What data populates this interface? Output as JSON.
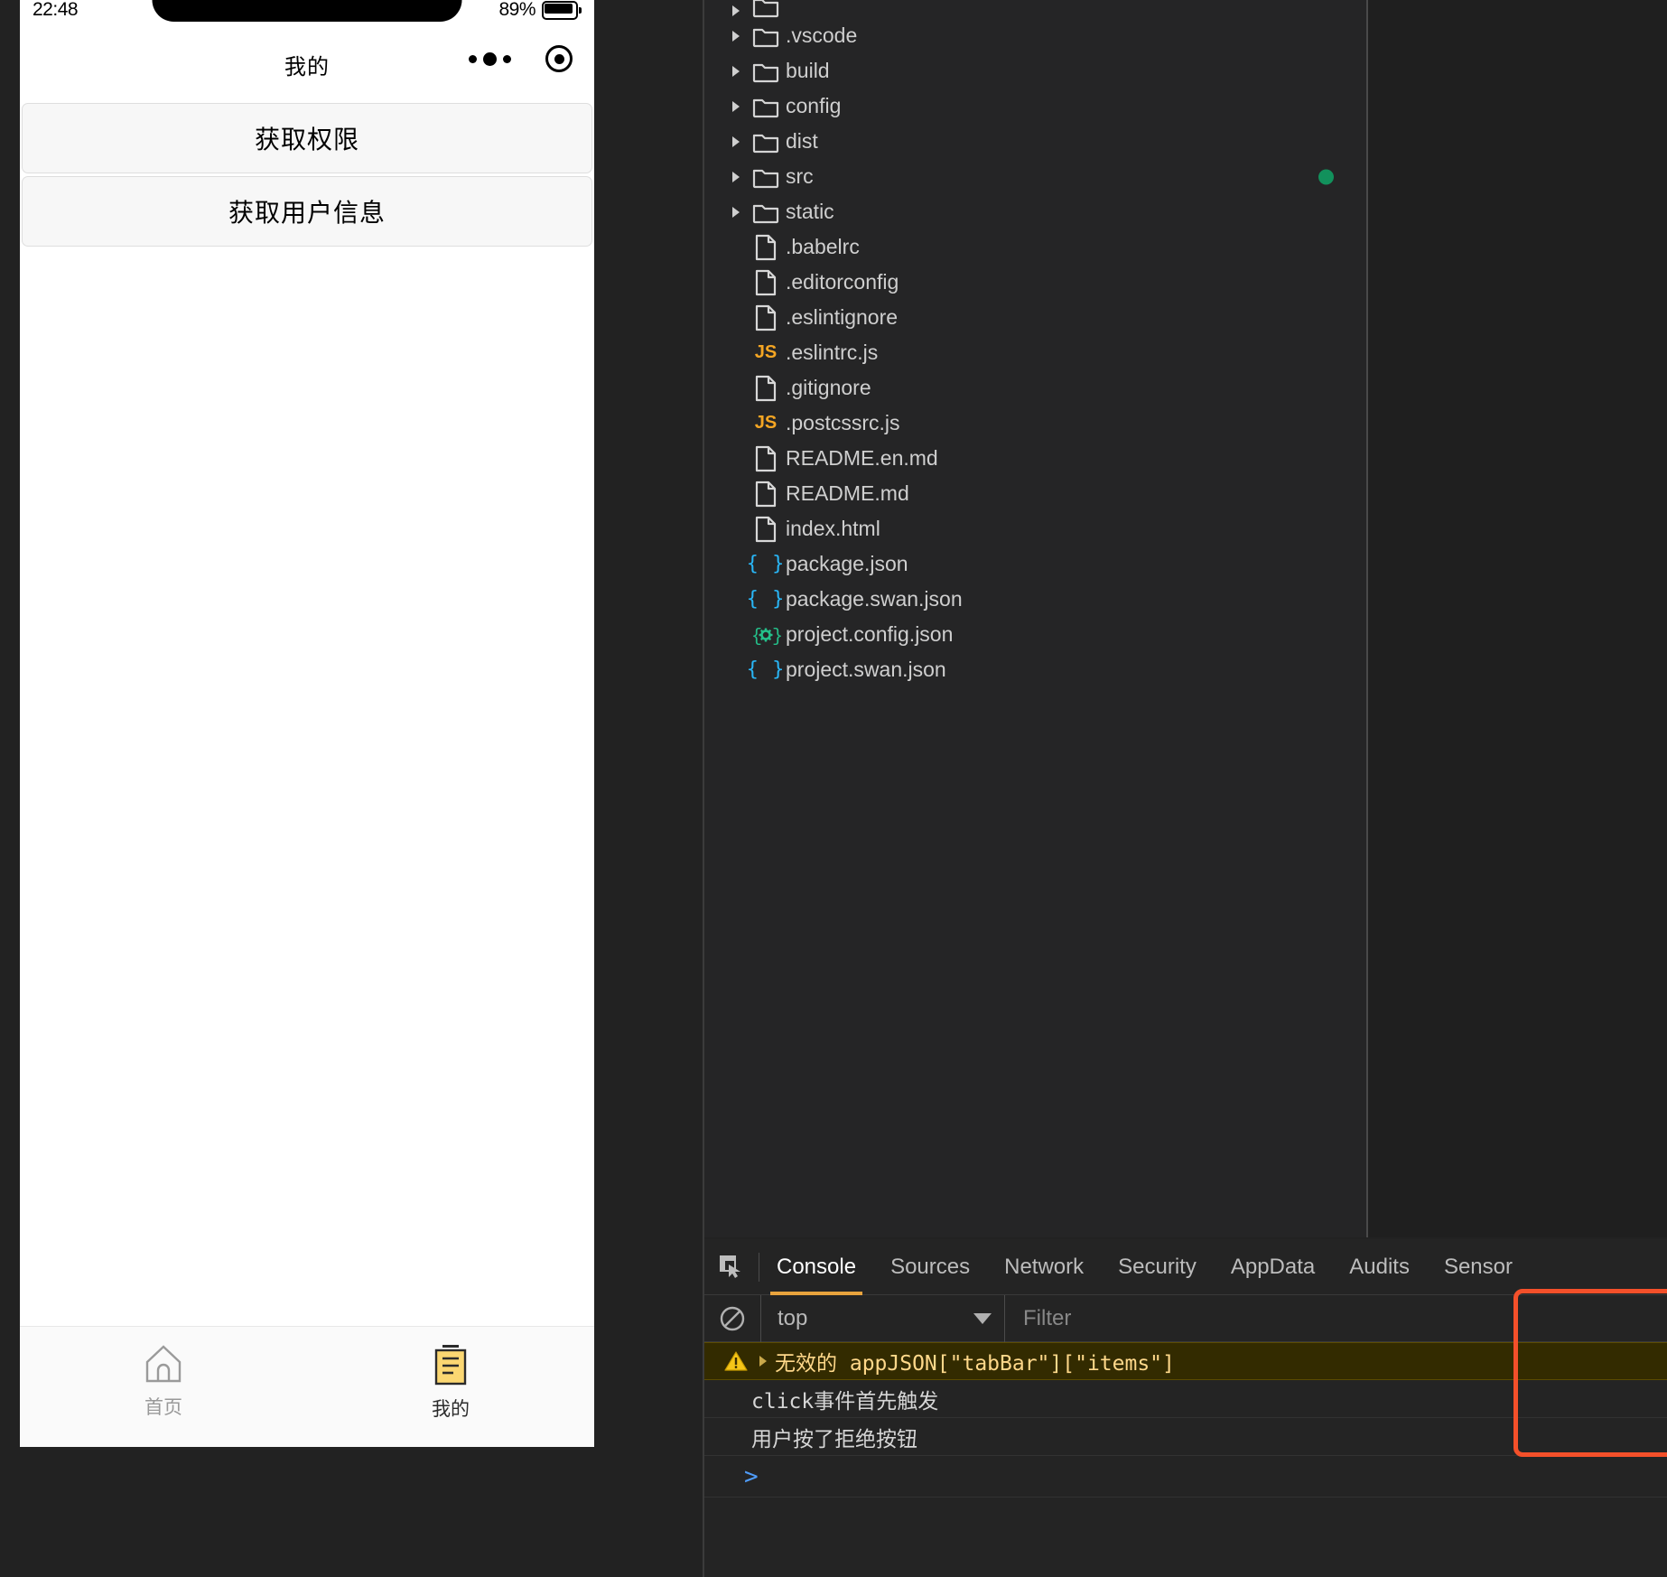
{
  "phone": {
    "status_bar": {
      "time": "22:48",
      "battery_percent": "89%",
      "battery_icon": "battery-icon"
    },
    "navbar": {
      "title": "我的",
      "more_icon": "more-dots-icon",
      "target_icon": "target-circle-icon"
    },
    "buttons": [
      {
        "label": "获取权限",
        "name": "get-permission-button"
      },
      {
        "label": "获取用户信息",
        "name": "get-userinfo-button"
      }
    ],
    "tabbar": [
      {
        "label": "首页",
        "icon": "home-icon",
        "active": false
      },
      {
        "label": "我的",
        "icon": "document-icon",
        "active": true
      }
    ]
  },
  "devtools": {
    "filetree": [
      {
        "label": "",
        "type": "folder",
        "cut": true
      },
      {
        "label": ".vscode",
        "type": "folder"
      },
      {
        "label": "build",
        "type": "folder"
      },
      {
        "label": "config",
        "type": "folder"
      },
      {
        "label": "dist",
        "type": "folder"
      },
      {
        "label": "src",
        "type": "folder",
        "git_dot": true
      },
      {
        "label": "static",
        "type": "folder"
      },
      {
        "label": ".babelrc",
        "type": "file"
      },
      {
        "label": ".editorconfig",
        "type": "file"
      },
      {
        "label": ".eslintignore",
        "type": "file"
      },
      {
        "label": ".eslintrc.js",
        "type": "js"
      },
      {
        "label": ".gitignore",
        "type": "file"
      },
      {
        "label": ".postcssrc.js",
        "type": "js"
      },
      {
        "label": "README.en.md",
        "type": "file"
      },
      {
        "label": "README.md",
        "type": "file"
      },
      {
        "label": "index.html",
        "type": "file"
      },
      {
        "label": "package.json",
        "type": "json"
      },
      {
        "label": "package.swan.json",
        "type": "json"
      },
      {
        "label": "project.config.json",
        "type": "json-config"
      },
      {
        "label": "project.swan.json",
        "type": "json"
      }
    ],
    "panel_tabs": [
      {
        "label": "Console",
        "active": true
      },
      {
        "label": "Sources",
        "active": false
      },
      {
        "label": "Network",
        "active": false
      },
      {
        "label": "Security",
        "active": false
      },
      {
        "label": "AppData",
        "active": false
      },
      {
        "label": "Audits",
        "active": false
      },
      {
        "label": "Sensor",
        "active": false
      }
    ],
    "toolbar": {
      "clear_icon": "no-entry-clear-icon",
      "inspect_icon": "inspect-cursor-icon",
      "context": "top",
      "context_caret": "chevron-down-icon",
      "filter_placeholder": "Filter"
    },
    "console_rows": [
      {
        "kind": "warning",
        "icon": "warning-triangle-icon",
        "arrow": "expand-arrow-icon",
        "text": "无效的 appJSON[\"tabBar\"][\"items\"]"
      },
      {
        "kind": "log",
        "text": "click事件首先触发"
      },
      {
        "kind": "log",
        "text": "用户按了拒绝按钮"
      },
      {
        "kind": "prompt",
        "text": ">"
      }
    ],
    "annotation": {
      "name": "red-highlight-box",
      "color": "#f4502a"
    }
  },
  "colors": {
    "accent_orange": "#e8a33d",
    "warning_bg": "#332b00",
    "warning_text": "#ffd88a",
    "git_green": "#12915c",
    "json_blue": "#29b6f6",
    "js_yellow": "#f5a623",
    "tab_active_gold": "#f7cd6b",
    "annotation_red": "#f4502a"
  }
}
